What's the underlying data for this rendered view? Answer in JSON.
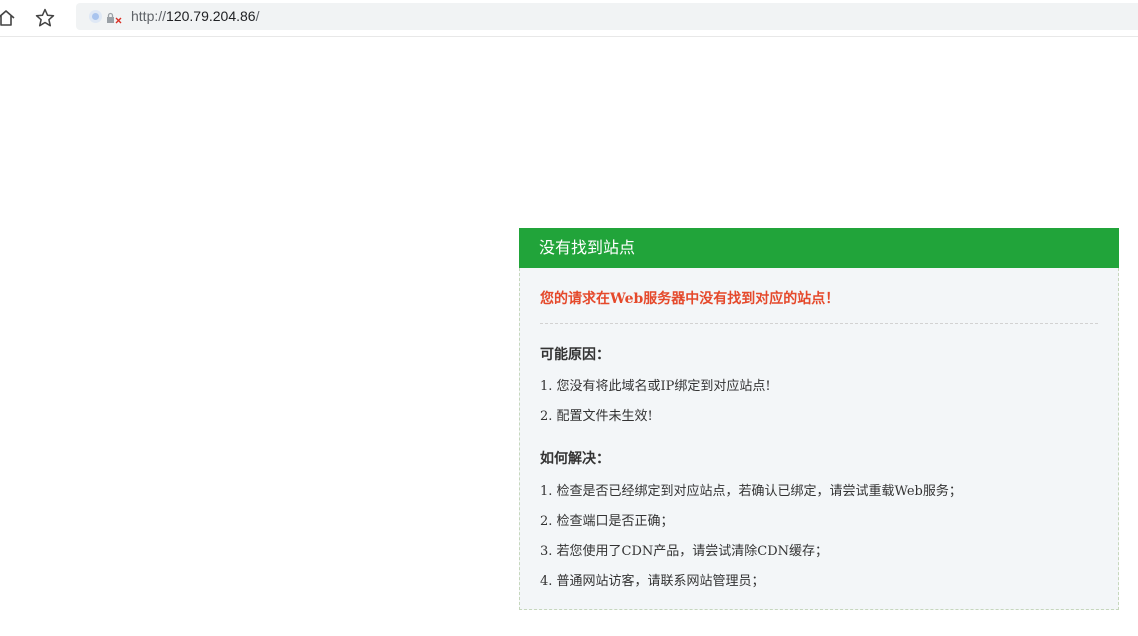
{
  "browser": {
    "address": {
      "protocol": "http://",
      "host": "120.79.204.86",
      "path": "/"
    }
  },
  "panel": {
    "header_title": "没有找到站点",
    "headline": "您的请求在Web服务器中没有找到对应的站点！",
    "reasons_title": "可能原因：",
    "reasons": [
      "1. 您没有将此域名或IP绑定到对应站点!",
      "2. 配置文件未生效!"
    ],
    "solutions_title": "如何解决：",
    "solutions": [
      "1. 检查是否已经绑定到对应站点，若确认已绑定，请尝试重载Web服务；",
      "2. 检查端口是否正确；",
      "3. 若您使用了CDN产品，请尝试清除CDN缓存；",
      "4. 普通网站访客，请联系网站管理员；"
    ]
  },
  "colors": {
    "header_green": "#21a43a",
    "headline_red": "#e5492b",
    "panel_bg": "#f3f6f8"
  }
}
